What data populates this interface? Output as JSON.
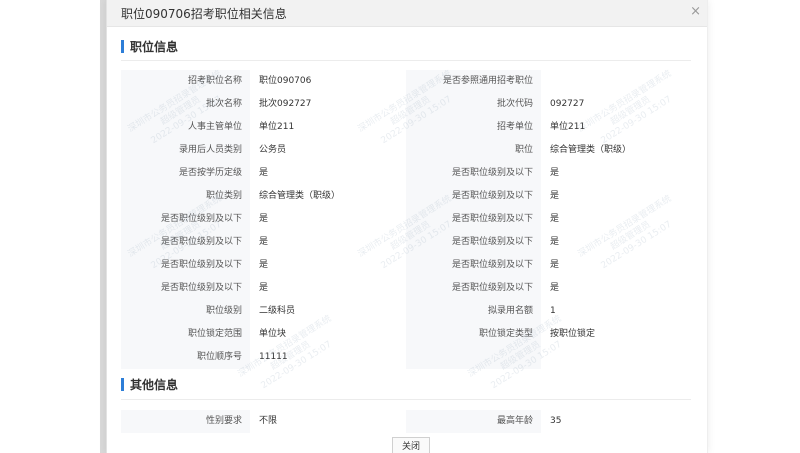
{
  "dialog": {
    "title": "职位090706招考职位相关信息",
    "close_icon": "×",
    "close_button": "关闭"
  },
  "sections": {
    "position_info": "职位信息",
    "other_info": "其他信息"
  },
  "rows": [
    {
      "l1": "招考职位名称",
      "v1": "职位090706",
      "l2": "是否参照通用招考职位",
      "v2": ""
    },
    {
      "l1": "批次名称",
      "v1": "批次092727",
      "l2": "批次代码",
      "v2": "092727"
    },
    {
      "l1": "人事主管单位",
      "v1": "单位211",
      "l2": "招考单位",
      "v2": "单位211"
    },
    {
      "l1": "录用后人员类别",
      "v1": "公务员",
      "l2": "职位",
      "v2": "综合管理类（职级）"
    },
    {
      "l1": "是否按学历定级",
      "v1": "是",
      "l2": "是否职位级别及以下",
      "v2": "是"
    },
    {
      "l1": "职位类别",
      "v1": "综合管理类（职级）",
      "l2": "是否职位级别及以下",
      "v2": "是"
    },
    {
      "l1": "是否职位级别及以下",
      "v1": "是",
      "l2": "是否职位级别及以下",
      "v2": "是"
    },
    {
      "l1": "是否职位级别及以下",
      "v1": "是",
      "l2": "是否职位级别及以下",
      "v2": "是"
    },
    {
      "l1": "是否职位级别及以下",
      "v1": "是",
      "l2": "是否职位级别及以下",
      "v2": "是"
    },
    {
      "l1": "是否职位级别及以下",
      "v1": "是",
      "l2": "是否职位级别及以下",
      "v2": "是"
    },
    {
      "l1": "职位级别",
      "v1": "二级科员",
      "l2": "拟录用名额",
      "v2": "1"
    },
    {
      "l1": "职位锁定范围",
      "v1": "单位块",
      "l2": "职位锁定类型",
      "v2": "按职位锁定"
    },
    {
      "l1": "职位顺序号",
      "v1": "11111",
      "l2": "",
      "v2": ""
    }
  ],
  "other_rows": [
    {
      "l1": "性别要求",
      "v1": "不限",
      "l2": "最高年龄",
      "v2": "35"
    }
  ],
  "watermark": {
    "line1": "深圳市公务员招录管理系统",
    "line2": "超级管理员",
    "line3": "2022-09-30 15:07"
  }
}
